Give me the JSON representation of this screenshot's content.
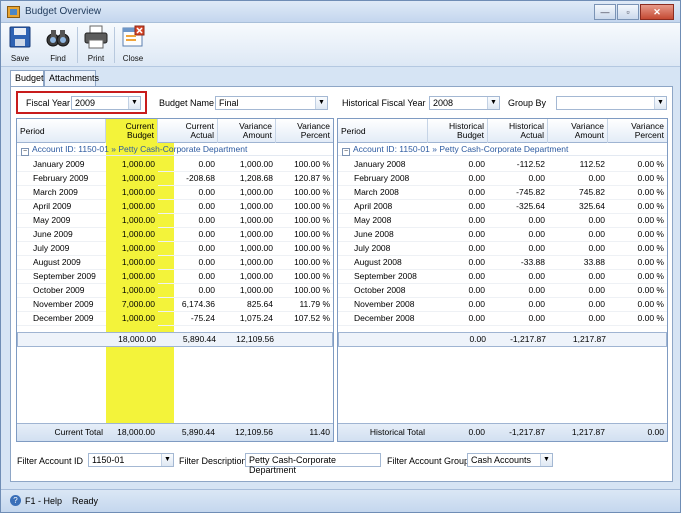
{
  "window": {
    "title": "Budget Overview",
    "controls": [
      "—",
      "▫",
      "✕"
    ]
  },
  "toolbar": {
    "save": "Save",
    "find": "Find",
    "print": "Print",
    "close": "Close"
  },
  "tabs": [
    "Budget",
    "Attachments"
  ],
  "filters": {
    "fiscal_year_label": "Fiscal Year",
    "fiscal_year": "2009",
    "budget_name_label": "Budget Name",
    "budget_name": "Final",
    "hist_fy_label": "Historical Fiscal Year",
    "hist_fy": "2008",
    "group_by_label": "Group By",
    "group_by": ""
  },
  "left_grid": {
    "headers": {
      "period": "Period",
      "cb1": "Current",
      "cb2": "Budget",
      "ca1": "Current",
      "ca2": "Actual",
      "va1": "Variance",
      "va2": "Amount",
      "vp1": "Variance",
      "vp2": "Percent"
    },
    "group": "Account ID: 1150-01",
    "group_desc": "» Petty Cash-Corporate Department",
    "rows": [
      [
        "January 2009",
        "1,000.00",
        "0.00",
        "1,000.00",
        "100.00 %"
      ],
      [
        "February 2009",
        "1,000.00",
        "-208.68",
        "1,208.68",
        "120.87 %"
      ],
      [
        "March 2009",
        "1,000.00",
        "0.00",
        "1,000.00",
        "100.00 %"
      ],
      [
        "April 2009",
        "1,000.00",
        "0.00",
        "1,000.00",
        "100.00 %"
      ],
      [
        "May 2009",
        "1,000.00",
        "0.00",
        "1,000.00",
        "100.00 %"
      ],
      [
        "June 2009",
        "1,000.00",
        "0.00",
        "1,000.00",
        "100.00 %"
      ],
      [
        "July 2009",
        "1,000.00",
        "0.00",
        "1,000.00",
        "100.00 %"
      ],
      [
        "August 2009",
        "1,000.00",
        "0.00",
        "1,000.00",
        "100.00 %"
      ],
      [
        "September 2009",
        "1,000.00",
        "0.00",
        "1,000.00",
        "100.00 %"
      ],
      [
        "October 2009",
        "1,000.00",
        "0.00",
        "1,000.00",
        "100.00 %"
      ],
      [
        "November 2009",
        "7,000.00",
        "6,174.36",
        "825.64",
        "11.79 %"
      ],
      [
        "December 2009",
        "1,000.00",
        "-75.24",
        "1,075.24",
        "107.52 %"
      ]
    ],
    "subtotal": [
      "18,000.00",
      "5,890.44",
      "12,109.56"
    ],
    "total_label": "Current Total",
    "total": [
      "18,000.00",
      "5,890.44",
      "12,109.56",
      "11.40"
    ]
  },
  "right_grid": {
    "headers": {
      "period": "Period",
      "hb1": "Historical",
      "hb2": "Budget",
      "ha1": "Historical",
      "ha2": "Actual",
      "va1": "Variance",
      "va2": "Amount",
      "vp1": "Variance",
      "vp2": "Percent"
    },
    "group": "Account ID: 1150-01",
    "group_desc": "» Petty Cash-Corporate Department",
    "rows": [
      [
        "January 2008",
        "0.00",
        "-112.52",
        "112.52",
        "0.00 %"
      ],
      [
        "February 2008",
        "0.00",
        "0.00",
        "0.00",
        "0.00 %"
      ],
      [
        "March 2008",
        "0.00",
        "-745.82",
        "745.82",
        "0.00 %"
      ],
      [
        "April 2008",
        "0.00",
        "-325.64",
        "325.64",
        "0.00 %"
      ],
      [
        "May 2008",
        "0.00",
        "0.00",
        "0.00",
        "0.00 %"
      ],
      [
        "June 2008",
        "0.00",
        "0.00",
        "0.00",
        "0.00 %"
      ],
      [
        "July 2008",
        "0.00",
        "0.00",
        "0.00",
        "0.00 %"
      ],
      [
        "August 2008",
        "0.00",
        "-33.88",
        "33.88",
        "0.00 %"
      ],
      [
        "September 2008",
        "0.00",
        "0.00",
        "0.00",
        "0.00 %"
      ],
      [
        "October 2008",
        "0.00",
        "0.00",
        "0.00",
        "0.00 %"
      ],
      [
        "November 2008",
        "0.00",
        "0.00",
        "0.00",
        "0.00 %"
      ],
      [
        "December 2008",
        "0.00",
        "0.00",
        "0.00",
        "0.00 %"
      ]
    ],
    "subtotal": [
      "0.00",
      "-1,217.87",
      "1,217.87"
    ],
    "total_label": "Historical Total",
    "total": [
      "0.00",
      "-1,217.87",
      "1,217.87",
      "0.00"
    ]
  },
  "bottom": {
    "filter_account_label": "Filter Account ID",
    "filter_account": "1150-01",
    "filter_desc_label": "Filter Description",
    "filter_desc": "Petty Cash-Corporate Department",
    "filter_group_label": "Filter Account Group",
    "filter_group": "Cash Accounts"
  },
  "status": {
    "help": "F1 - Help",
    "state": "Ready"
  },
  "colors": {
    "highlight": "#f3f33a",
    "accent": "#2c5aa0",
    "fy_border": "#c81c1c"
  }
}
